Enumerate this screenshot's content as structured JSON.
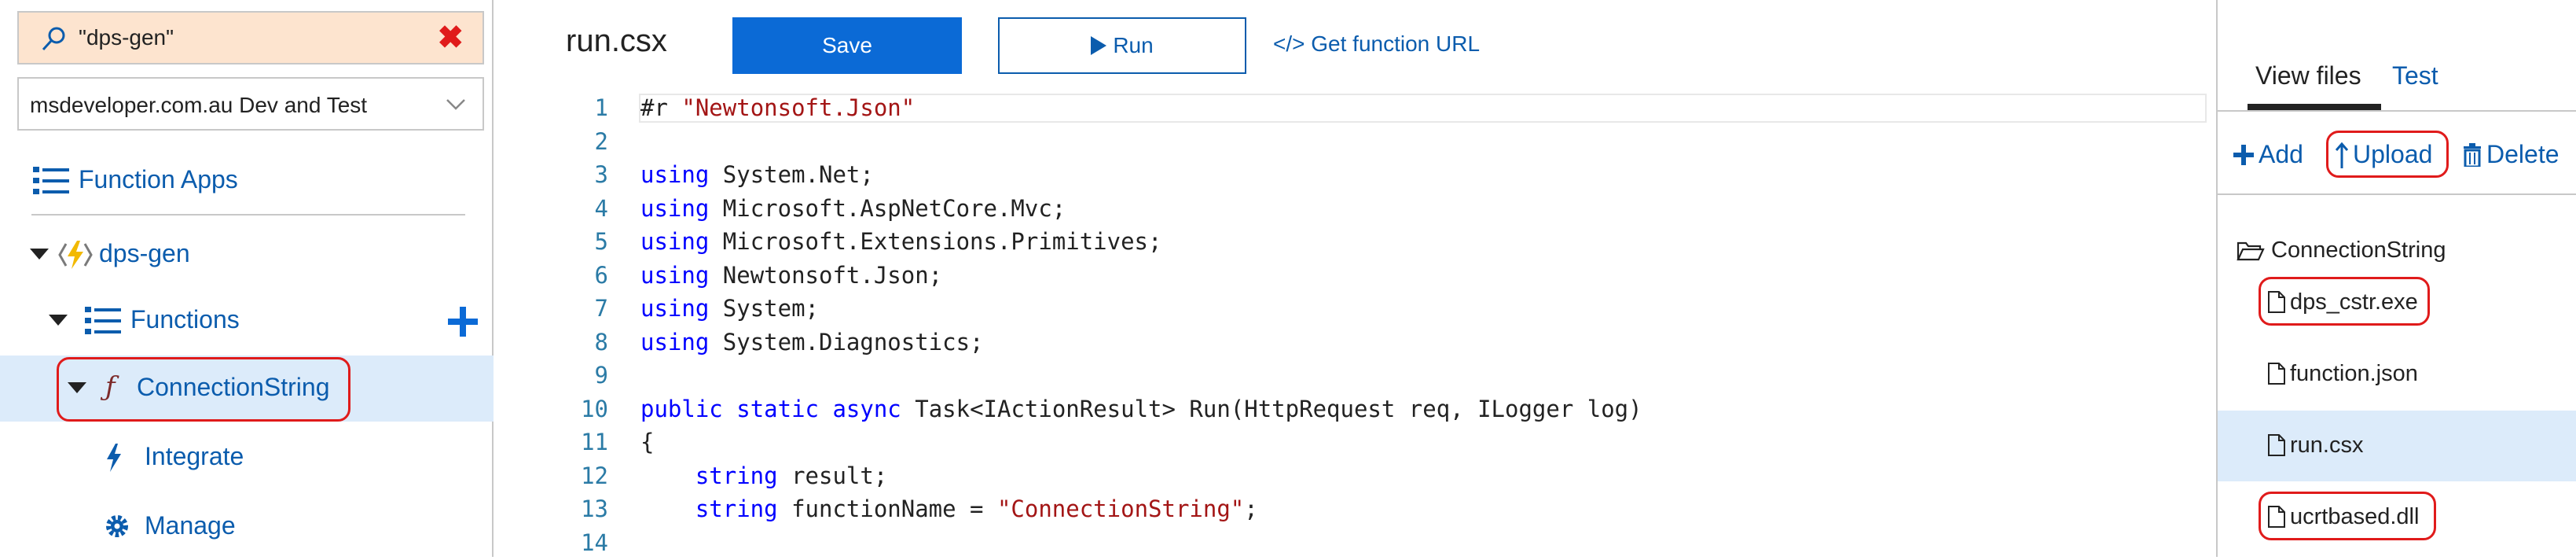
{
  "search": {
    "value": "\"dps-gen\""
  },
  "subscription": {
    "value": "msdeveloper.com.au Dev and Test"
  },
  "nav": {
    "function_apps": "Function Apps",
    "app_name": "dps-gen",
    "functions": "Functions",
    "function_name": "ConnectionString",
    "integrate": "Integrate",
    "manage": "Manage"
  },
  "editor": {
    "file_title": "run.csx",
    "save_label": "Save",
    "run_label": "Run",
    "get_url_label": "</> Get function URL",
    "code_lines": [
      {
        "n": "1",
        "parts": [
          [
            "plain",
            "#r "
          ],
          [
            "str",
            "\"Newtonsoft.Json\""
          ]
        ]
      },
      {
        "n": "2",
        "parts": []
      },
      {
        "n": "3",
        "parts": [
          [
            "kw",
            "using"
          ],
          [
            "plain",
            " System.Net;"
          ]
        ]
      },
      {
        "n": "4",
        "parts": [
          [
            "kw",
            "using"
          ],
          [
            "plain",
            " Microsoft.AspNetCore.Mvc;"
          ]
        ]
      },
      {
        "n": "5",
        "parts": [
          [
            "kw",
            "using"
          ],
          [
            "plain",
            " Microsoft.Extensions.Primitives;"
          ]
        ]
      },
      {
        "n": "6",
        "parts": [
          [
            "kw",
            "using"
          ],
          [
            "plain",
            " Newtonsoft.Json;"
          ]
        ]
      },
      {
        "n": "7",
        "parts": [
          [
            "kw",
            "using"
          ],
          [
            "plain",
            " System;"
          ]
        ]
      },
      {
        "n": "8",
        "parts": [
          [
            "kw",
            "using"
          ],
          [
            "plain",
            " System.Diagnostics;"
          ]
        ]
      },
      {
        "n": "9",
        "parts": []
      },
      {
        "n": "10",
        "parts": [
          [
            "kw",
            "public"
          ],
          [
            "plain",
            " "
          ],
          [
            "kw",
            "static"
          ],
          [
            "plain",
            " "
          ],
          [
            "kw",
            "async"
          ],
          [
            "plain",
            " Task<IActionResult> Run(HttpRequest req, ILogger log)"
          ]
        ]
      },
      {
        "n": "11",
        "parts": [
          [
            "plain",
            "{"
          ]
        ]
      },
      {
        "n": "12",
        "parts": [
          [
            "plain",
            "    "
          ],
          [
            "kw",
            "string"
          ],
          [
            "plain",
            " result;"
          ]
        ]
      },
      {
        "n": "13",
        "parts": [
          [
            "plain",
            "    "
          ],
          [
            "kw",
            "string"
          ],
          [
            "plain",
            " functionName = "
          ],
          [
            "str",
            "\"ConnectionString\""
          ],
          [
            "plain",
            ";"
          ]
        ]
      },
      {
        "n": "14",
        "parts": []
      }
    ]
  },
  "files_panel": {
    "tab_view_files": "View files",
    "tab_test": "Test",
    "add_label": "Add",
    "upload_label": "Upload",
    "delete_label": "Delete",
    "folder": "ConnectionString",
    "files": [
      "dps_cstr.exe",
      "function.json",
      "run.csx",
      "ucrtbased.dll"
    ],
    "selected_file": "run.csx"
  },
  "colors": {
    "accent": "#0b5cad",
    "save_bg": "#0b6ad6",
    "highlight_circle": "#e01b1b",
    "search_bg": "#fde4cf",
    "selected_row": "#dcebfa"
  }
}
